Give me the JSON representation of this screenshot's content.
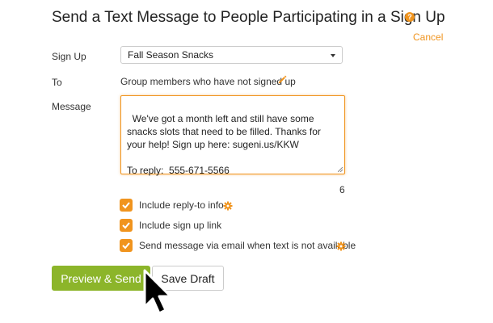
{
  "header": {
    "title": "Send a Text Message to People Participating in a Sign Up",
    "help_icon": "question-circle-icon",
    "cancel_label": "Cancel"
  },
  "form": {
    "signup_label": "Sign Up",
    "signup_value": "Fall Season Snacks",
    "to_label": "To",
    "to_value": "Group members who have not signed up",
    "to_edit_icon": "pencil-icon",
    "message_label": "Message",
    "message_value": "We've got a month left and still have some snacks slots that need to be filled. Thanks for your help! Sign up here: sugeni.us/KKW\n\nTo reply:  555-671-5566",
    "char_count": "6"
  },
  "options": [
    {
      "label": "Include reply-to info",
      "checked": true,
      "icon": "gear-icon"
    },
    {
      "label": "Include sign up link",
      "checked": true
    },
    {
      "label": "Send message via email when text is not available",
      "checked": true,
      "icon": "gear-icon"
    }
  ],
  "actions": {
    "preview_label": "Preview & Send",
    "draft_label": "Save Draft"
  },
  "colors": {
    "accent": "#f0941e",
    "primary_button": "#8cb52a"
  }
}
